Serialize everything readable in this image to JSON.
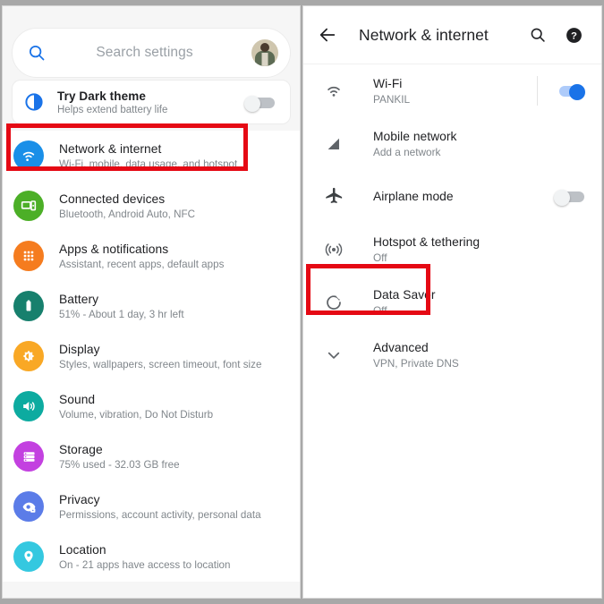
{
  "left_panel": {
    "search": {
      "placeholder": "Search settings",
      "icon": "search-icon",
      "avatar": "user-avatar"
    },
    "dark_theme": {
      "title": "Try Dark theme",
      "subtitle": "Helps extend battery life",
      "icon": "dark-theme-icon",
      "toggle_state": "off"
    },
    "items": [
      {
        "title": "Network & internet",
        "subtitle": "Wi-Fi, mobile, data usage, and hotspot",
        "icon": "wifi-icon",
        "color": "#1a8fe8",
        "highlighted": true
      },
      {
        "title": "Connected devices",
        "subtitle": "Bluetooth, Android Auto, NFC",
        "icon": "connected-devices-icon",
        "color": "#4caf27",
        "highlighted": false
      },
      {
        "title": "Apps & notifications",
        "subtitle": "Assistant, recent apps, default apps",
        "icon": "apps-grid-icon",
        "color": "#f57c1f",
        "highlighted": false
      },
      {
        "title": "Battery",
        "subtitle": "51% - About 1 day, 3 hr left",
        "icon": "battery-icon",
        "color": "#17806d",
        "highlighted": false
      },
      {
        "title": "Display",
        "subtitle": "Styles, wallpapers, screen timeout, font size",
        "icon": "brightness-icon",
        "color": "#f9a825",
        "highlighted": false
      },
      {
        "title": "Sound",
        "subtitle": "Volume, vibration, Do Not Disturb",
        "icon": "speaker-icon",
        "color": "#0daba0",
        "highlighted": false
      },
      {
        "title": "Storage",
        "subtitle": "75% used - 32.03 GB free",
        "icon": "storage-icon",
        "color": "#c341e0",
        "highlighted": false
      },
      {
        "title": "Privacy",
        "subtitle": "Permissions, account activity, personal data",
        "icon": "privacy-eye-lock-icon",
        "color": "#5b7ce8",
        "highlighted": false
      },
      {
        "title": "Location",
        "subtitle": "On - 21 apps have access to location",
        "icon": "location-pin-icon",
        "color": "#34c8e0",
        "highlighted": false
      }
    ]
  },
  "right_panel": {
    "header": {
      "back_icon": "back-arrow-icon",
      "title": "Network & internet",
      "search_icon": "search-icon",
      "help_icon": "help-icon"
    },
    "items": [
      {
        "title": "Wi-Fi",
        "subtitle": "PANKIL",
        "icon": "wifi-icon",
        "toggle": "on",
        "divider": true,
        "highlighted": false
      },
      {
        "title": "Mobile network",
        "subtitle": "Add a network",
        "icon": "signal-bars-icon",
        "toggle": "none",
        "divider": false,
        "highlighted": false
      },
      {
        "title": "Airplane mode",
        "subtitle": "",
        "icon": "airplane-icon",
        "toggle": "off",
        "divider": false,
        "highlighted": false
      },
      {
        "title": "Hotspot & tethering",
        "subtitle": "Off",
        "icon": "hotspot-icon",
        "toggle": "none",
        "divider": false,
        "highlighted": false
      },
      {
        "title": "Data Saver",
        "subtitle": "Off",
        "icon": "data-saver-icon",
        "toggle": "none",
        "divider": false,
        "highlighted": true
      },
      {
        "title": "Advanced",
        "subtitle": "VPN, Private DNS",
        "icon": "chevron-down-icon",
        "toggle": "none",
        "divider": false,
        "highlighted": false
      }
    ]
  },
  "annotations": {
    "highlight_color": "#e50914",
    "highlight_targets": [
      "Network & internet",
      "Data Saver"
    ]
  }
}
